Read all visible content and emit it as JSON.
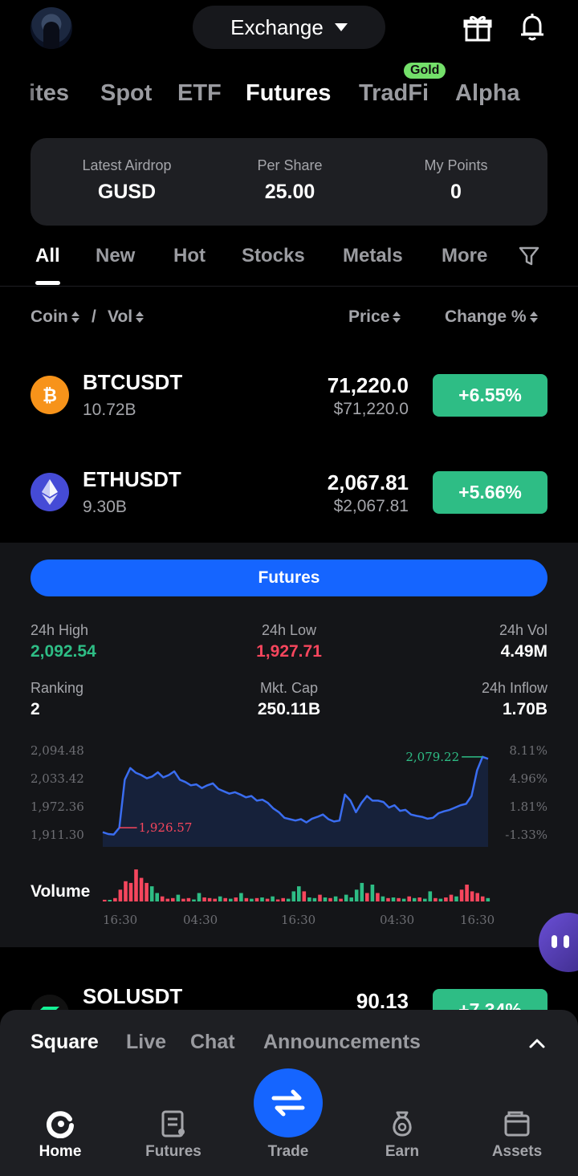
{
  "topbar": {
    "switcher_label": "Exchange",
    "icons": [
      "gift-icon",
      "bell-icon"
    ]
  },
  "market_tabs": [
    {
      "label": "ites"
    },
    {
      "label": "Spot"
    },
    {
      "label": "ETF"
    },
    {
      "label": "Futures",
      "active": true
    },
    {
      "label": "TradFi"
    },
    {
      "label": "Alpha"
    }
  ],
  "gold_badge": "Gold",
  "airdrop": {
    "latest_label": "Latest Airdrop",
    "latest_value": "GUSD",
    "per_share_label": "Per Share",
    "per_share_value": "25.00",
    "points_label": "My Points",
    "points_value": "0"
  },
  "category_tabs": [
    {
      "label": "All",
      "active": true
    },
    {
      "label": "New"
    },
    {
      "label": "Hot"
    },
    {
      "label": "Stocks"
    },
    {
      "label": "Metals"
    },
    {
      "label": "More"
    }
  ],
  "table_header": {
    "coin": "Coin",
    "slash": "/",
    "vol": "Vol",
    "price": "Price",
    "change": "Change %"
  },
  "rows": [
    {
      "symbol": "BTCUSDT",
      "volume": "10.72B",
      "price": "71,220.0",
      "usd_price": "$71,220.0",
      "change": "+6.55%",
      "icon": "bitcoin-icon"
    },
    {
      "symbol": "ETHUSDT",
      "volume": "9.30B",
      "price": "2,067.81",
      "usd_price": "$2,067.81",
      "change": "+5.66%",
      "icon": "ethereum-icon"
    },
    {
      "symbol": "SOLUSDT",
      "price": "90.13",
      "change": "+7.34%",
      "icon": "solana-icon"
    }
  ],
  "detail": {
    "button_label": "Futures",
    "high_label": "24h High",
    "high_value": "2,092.54",
    "low_label": "24h Low",
    "low_value": "1,927.71",
    "vol_label": "24h Vol",
    "vol_value": "4.49M",
    "rank_label": "Ranking",
    "rank_value": "2",
    "cap_label": "Mkt. Cap",
    "cap_value": "250.11B",
    "inflow_label": "24h Inflow",
    "inflow_value": "1.70B",
    "volume_label": "Volume",
    "price_marker_high": "2,079.22",
    "price_marker_low": "1,926.57"
  },
  "chart_data": {
    "type": "line",
    "y_left_ticks": [
      "2,094.48",
      "2,033.42",
      "1,972.36",
      "1,911.30"
    ],
    "y_right_ticks": [
      "8.11%",
      "4.96%",
      "1.81%",
      "-1.33%"
    ],
    "x_ticks": [
      "16:30",
      "04:30",
      "16:30",
      "04:30",
      "16:30"
    ],
    "ylim": [
      1911.3,
      2094.48
    ],
    "price": [
      1917,
      1913,
      1912,
      1926.57,
      2030,
      2055,
      2045,
      2040,
      2033,
      2037,
      2046,
      2035,
      2040,
      2048,
      2030,
      2025,
      2018,
      2020,
      2012,
      2018,
      2022,
      2010,
      2005,
      2000,
      2003,
      1998,
      1992,
      1995,
      1985,
      1987,
      1980,
      1968,
      1960,
      1948,
      1945,
      1942,
      1945,
      1938,
      1946,
      1950,
      1955,
      1945,
      1940,
      1942,
      1998,
      1985,
      1960,
      1980,
      1995,
      1985,
      1985,
      1982,
      1970,
      1975,
      1963,
      1965,
      1955,
      1952,
      1950,
      1946,
      1948,
      1958,
      1962,
      1965,
      1970,
      1975,
      1978,
      1995,
      2050,
      2079.22,
      2075
    ],
    "volume": [
      0.05,
      0.04,
      0.1,
      0.35,
      0.6,
      0.55,
      0.95,
      0.7,
      0.55,
      0.45,
      0.25,
      0.15,
      0.08,
      0.1,
      0.2,
      0.08,
      0.1,
      0.06,
      0.25,
      0.12,
      0.1,
      0.08,
      0.15,
      0.1,
      0.08,
      0.12,
      0.25,
      0.1,
      0.08,
      0.1,
      0.12,
      0.08,
      0.15,
      0.06,
      0.1,
      0.08,
      0.3,
      0.45,
      0.3,
      0.12,
      0.1,
      0.2,
      0.12,
      0.1,
      0.15,
      0.08,
      0.2,
      0.12,
      0.35,
      0.55,
      0.25,
      0.5,
      0.25,
      0.15,
      0.1,
      0.12,
      0.1,
      0.08,
      0.15,
      0.1,
      0.12,
      0.08,
      0.3,
      0.1,
      0.08,
      0.12,
      0.2,
      0.15,
      0.35,
      0.5,
      0.3,
      0.25,
      0.15,
      0.1
    ],
    "volume_colors": [
      "r",
      "g",
      "r",
      "r",
      "r",
      "r",
      "r",
      "r",
      "r",
      "g",
      "g",
      "r",
      "r",
      "r",
      "g",
      "r",
      "r",
      "g",
      "g",
      "r",
      "r",
      "r",
      "g",
      "r",
      "g",
      "r",
      "g",
      "r",
      "g",
      "r",
      "g",
      "r",
      "g",
      "r",
      "r",
      "g",
      "g",
      "g",
      "r",
      "g",
      "g",
      "r",
      "g",
      "r",
      "g",
      "r",
      "g",
      "g",
      "g",
      "g",
      "r",
      "g",
      "r",
      "g",
      "r",
      "g",
      "r",
      "g",
      "r",
      "g",
      "r",
      "g",
      "g",
      "r",
      "g",
      "r",
      "r",
      "g",
      "r",
      "r",
      "r",
      "r",
      "r",
      "g"
    ]
  },
  "float_button": "chat-bubble-icon",
  "sheet_tabs": [
    {
      "label": "Square",
      "active": true
    },
    {
      "label": "Live"
    },
    {
      "label": "Chat"
    },
    {
      "label": "Announcements"
    }
  ],
  "bottom_nav": [
    {
      "label": "Home",
      "icon": "home-icon",
      "active": true
    },
    {
      "label": "Futures",
      "icon": "futures-icon"
    },
    {
      "label": "Trade",
      "icon": "swap-icon"
    },
    {
      "label": "Earn",
      "icon": "earn-icon"
    },
    {
      "label": "Assets",
      "icon": "wallet-icon"
    }
  ],
  "colors": {
    "up": "#2ebd85",
    "down": "#f6465d",
    "accent": "#1565ff",
    "line": "#3a6df0"
  }
}
